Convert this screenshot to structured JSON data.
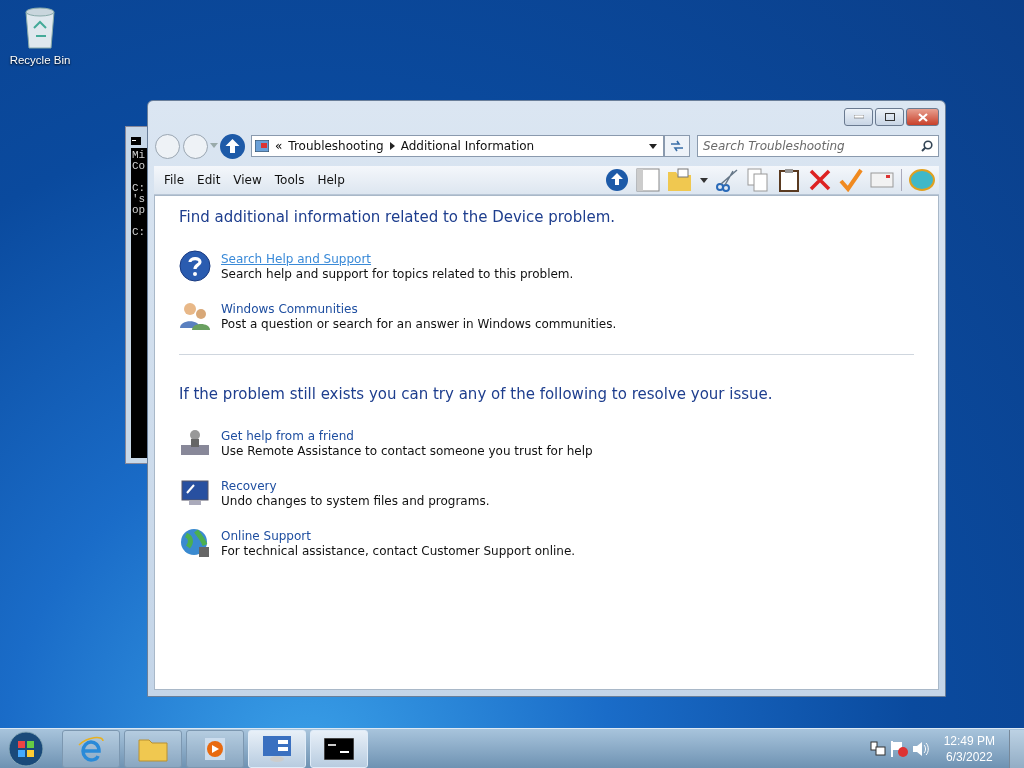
{
  "desktop_icons": [
    {
      "label": "Recycle Bin"
    }
  ],
  "console_window": {
    "lines": [
      {
        "text": "Mi",
        "blank_before": false
      },
      {
        "text": "Co",
        "blank_before": false
      },
      {
        "text": "C:",
        "blank_before": true
      },
      {
        "text": "'s",
        "blank_before": false
      },
      {
        "text": "op",
        "blank_before": false
      },
      {
        "text": "C:",
        "blank_before": true
      }
    ]
  },
  "window": {
    "overflow": "«",
    "breadcrumb": [
      "Troubleshooting",
      "Additional Information"
    ],
    "search": {
      "placeholder": "Search Troubleshooting"
    },
    "menu": [
      "File",
      "Edit",
      "View",
      "Tools",
      "Help"
    ]
  },
  "sections": [
    {
      "heading": "Find additional information related to the Device problem.",
      "items": [
        {
          "kind": "help",
          "title": "Search Help and Support",
          "description": "Search help and support for topics related to this problem.",
          "hovered": true
        },
        {
          "kind": "community",
          "title": "Windows Communities",
          "description": "Post a question or search for an answer in Windows communities.",
          "hovered": false
        }
      ]
    },
    {
      "heading": "If the problem still exists you can try any of the following to resolve your issue.",
      "items": [
        {
          "kind": "assist",
          "title": "Get help from a friend",
          "description": "Use Remote Assistance to contact someone you trust for help",
          "hovered": false
        },
        {
          "kind": "recovery",
          "title": "Recovery",
          "description": "Undo changes to system files and programs.",
          "hovered": false
        },
        {
          "kind": "globe",
          "title": "Online Support",
          "description": "For technical assistance, contact Customer Support online.",
          "hovered": false
        }
      ]
    }
  ],
  "taskbar": {
    "apps": [
      {
        "kind": "ie",
        "active": false
      },
      {
        "kind": "folder",
        "active": false
      },
      {
        "kind": "media",
        "active": false
      },
      {
        "kind": "control",
        "active": true
      },
      {
        "kind": "console",
        "active": true
      }
    ],
    "clock": {
      "time": "12:49 PM",
      "date": "6/3/2022"
    }
  }
}
